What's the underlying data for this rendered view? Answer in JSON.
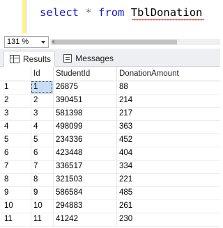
{
  "editor": {
    "keyword_select": "select",
    "star": "*",
    "keyword_from": "from",
    "table_name": "TblDonation"
  },
  "zoom": {
    "value": "131 %"
  },
  "tabs": [
    {
      "label": "Results"
    },
    {
      "label": "Messages"
    }
  ],
  "grid": {
    "columns": [
      "Id",
      "StudentId",
      "DonationAmount"
    ],
    "rows": [
      {
        "num": "1",
        "id": "1",
        "student_id": "26875",
        "amount": "88"
      },
      {
        "num": "2",
        "id": "2",
        "student_id": "390451",
        "amount": "214"
      },
      {
        "num": "3",
        "id": "3",
        "student_id": "581398",
        "amount": "217"
      },
      {
        "num": "4",
        "id": "4",
        "student_id": "498099",
        "amount": "363"
      },
      {
        "num": "5",
        "id": "5",
        "student_id": "234336",
        "amount": "452"
      },
      {
        "num": "6",
        "id": "6",
        "student_id": "423448",
        "amount": "404"
      },
      {
        "num": "7",
        "id": "7",
        "student_id": "336517",
        "amount": "334"
      },
      {
        "num": "8",
        "id": "8",
        "student_id": "321503",
        "amount": "221"
      },
      {
        "num": "9",
        "id": "9",
        "student_id": "586584",
        "amount": "485"
      },
      {
        "num": "10",
        "id": "10",
        "student_id": "294883",
        "amount": "261"
      },
      {
        "num": "11",
        "id": "11",
        "student_id": "41242",
        "amount": "230"
      }
    ]
  },
  "colors": {
    "keyword": "#1515d4",
    "margin_highlight": "#fff28a",
    "selected_cell": "#c9def5"
  }
}
